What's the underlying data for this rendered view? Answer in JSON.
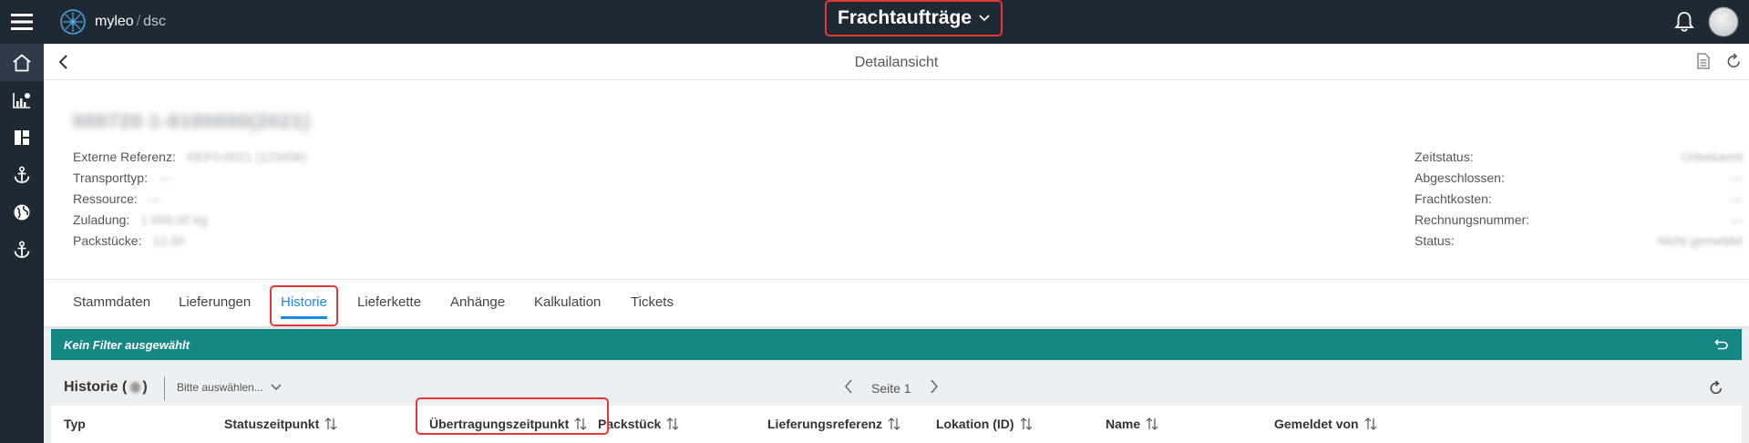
{
  "app": {
    "brand": "myleo",
    "sub": "dsc",
    "title": "Frachtaufträge"
  },
  "subheader": {
    "title": "Detailansicht"
  },
  "detail": {
    "id": "000720-1-6100000(2021)",
    "left_fields": [
      {
        "label": "Externe Referenz:",
        "value": "REF0-0021 (123456)"
      },
      {
        "label": "Transporttyp:",
        "value": "—"
      },
      {
        "label": "Ressource:",
        "value": "—"
      },
      {
        "label": "Zuladung:",
        "value": "1.000,00 kg"
      },
      {
        "label": "Packstücke:",
        "value": "12,00"
      }
    ],
    "right_fields": [
      {
        "label": "Zeitstatus:",
        "value": "Unbekannt"
      },
      {
        "label": "Abgeschlossen:",
        "value": "—"
      },
      {
        "label": "Frachtkosten:",
        "value": "—"
      },
      {
        "label": "Rechnungsnummer:",
        "value": "—"
      },
      {
        "label": "Status:",
        "value": "Nicht gemeldet"
      }
    ]
  },
  "tabs": [
    "Stammdaten",
    "Lieferungen",
    "Historie",
    "Lieferkette",
    "Anhänge",
    "Kalkulation",
    "Tickets"
  ],
  "active_tab": "Historie",
  "filter": {
    "text": "Kein Filter ausgewählt"
  },
  "history": {
    "title": "Historie (",
    "title_close": ")",
    "select_placeholder": "Bitte auswählen...",
    "page_label": "Seite 1"
  },
  "columns": [
    "Typ",
    "Statuszeitpunkt",
    "Übertragungszeitpunkt",
    "Packstück",
    "Lieferungsreferenz",
    "Lokation (ID)",
    "Name",
    "Gemeldet von"
  ],
  "colors": {
    "topbar": "#1f2933",
    "teal": "#168783",
    "accent": "#1e88e5",
    "highlight": "#e53935"
  },
  "icons": {
    "sidebar": [
      "home-icon",
      "analytics-icon",
      "dashboard-icon",
      "anchor-icon",
      "globe-icon",
      "anchor-icon"
    ],
    "subheader": [
      "document-icon",
      "refresh-icon"
    ]
  }
}
